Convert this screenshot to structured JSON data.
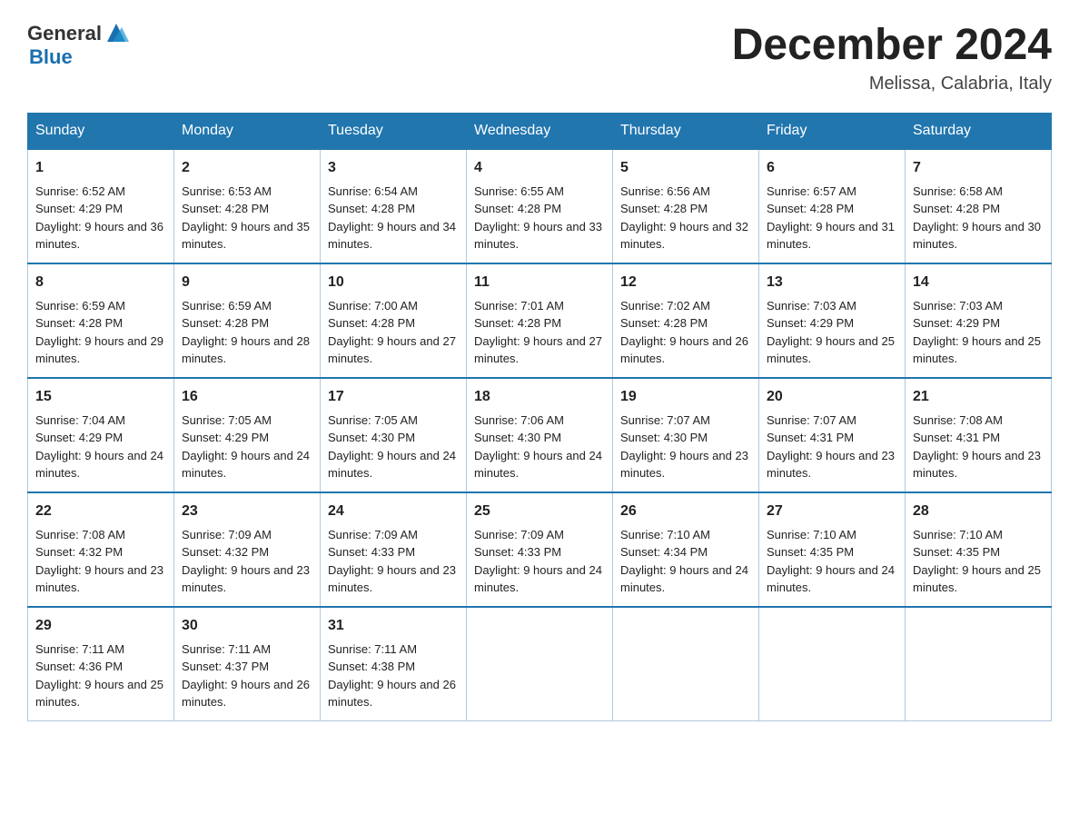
{
  "header": {
    "logo_general": "General",
    "logo_blue": "Blue",
    "month_title": "December 2024",
    "location": "Melissa, Calabria, Italy"
  },
  "weekdays": [
    "Sunday",
    "Monday",
    "Tuesday",
    "Wednesday",
    "Thursday",
    "Friday",
    "Saturday"
  ],
  "weeks": [
    [
      {
        "day": "1",
        "sunrise": "6:52 AM",
        "sunset": "4:29 PM",
        "daylight": "9 hours and 36 minutes."
      },
      {
        "day": "2",
        "sunrise": "6:53 AM",
        "sunset": "4:28 PM",
        "daylight": "9 hours and 35 minutes."
      },
      {
        "day": "3",
        "sunrise": "6:54 AM",
        "sunset": "4:28 PM",
        "daylight": "9 hours and 34 minutes."
      },
      {
        "day": "4",
        "sunrise": "6:55 AM",
        "sunset": "4:28 PM",
        "daylight": "9 hours and 33 minutes."
      },
      {
        "day": "5",
        "sunrise": "6:56 AM",
        "sunset": "4:28 PM",
        "daylight": "9 hours and 32 minutes."
      },
      {
        "day": "6",
        "sunrise": "6:57 AM",
        "sunset": "4:28 PM",
        "daylight": "9 hours and 31 minutes."
      },
      {
        "day": "7",
        "sunrise": "6:58 AM",
        "sunset": "4:28 PM",
        "daylight": "9 hours and 30 minutes."
      }
    ],
    [
      {
        "day": "8",
        "sunrise": "6:59 AM",
        "sunset": "4:28 PM",
        "daylight": "9 hours and 29 minutes."
      },
      {
        "day": "9",
        "sunrise": "6:59 AM",
        "sunset": "4:28 PM",
        "daylight": "9 hours and 28 minutes."
      },
      {
        "day": "10",
        "sunrise": "7:00 AM",
        "sunset": "4:28 PM",
        "daylight": "9 hours and 27 minutes."
      },
      {
        "day": "11",
        "sunrise": "7:01 AM",
        "sunset": "4:28 PM",
        "daylight": "9 hours and 27 minutes."
      },
      {
        "day": "12",
        "sunrise": "7:02 AM",
        "sunset": "4:28 PM",
        "daylight": "9 hours and 26 minutes."
      },
      {
        "day": "13",
        "sunrise": "7:03 AM",
        "sunset": "4:29 PM",
        "daylight": "9 hours and 25 minutes."
      },
      {
        "day": "14",
        "sunrise": "7:03 AM",
        "sunset": "4:29 PM",
        "daylight": "9 hours and 25 minutes."
      }
    ],
    [
      {
        "day": "15",
        "sunrise": "7:04 AM",
        "sunset": "4:29 PM",
        "daylight": "9 hours and 24 minutes."
      },
      {
        "day": "16",
        "sunrise": "7:05 AM",
        "sunset": "4:29 PM",
        "daylight": "9 hours and 24 minutes."
      },
      {
        "day": "17",
        "sunrise": "7:05 AM",
        "sunset": "4:30 PM",
        "daylight": "9 hours and 24 minutes."
      },
      {
        "day": "18",
        "sunrise": "7:06 AM",
        "sunset": "4:30 PM",
        "daylight": "9 hours and 24 minutes."
      },
      {
        "day": "19",
        "sunrise": "7:07 AM",
        "sunset": "4:30 PM",
        "daylight": "9 hours and 23 minutes."
      },
      {
        "day": "20",
        "sunrise": "7:07 AM",
        "sunset": "4:31 PM",
        "daylight": "9 hours and 23 minutes."
      },
      {
        "day": "21",
        "sunrise": "7:08 AM",
        "sunset": "4:31 PM",
        "daylight": "9 hours and 23 minutes."
      }
    ],
    [
      {
        "day": "22",
        "sunrise": "7:08 AM",
        "sunset": "4:32 PM",
        "daylight": "9 hours and 23 minutes."
      },
      {
        "day": "23",
        "sunrise": "7:09 AM",
        "sunset": "4:32 PM",
        "daylight": "9 hours and 23 minutes."
      },
      {
        "day": "24",
        "sunrise": "7:09 AM",
        "sunset": "4:33 PM",
        "daylight": "9 hours and 23 minutes."
      },
      {
        "day": "25",
        "sunrise": "7:09 AM",
        "sunset": "4:33 PM",
        "daylight": "9 hours and 24 minutes."
      },
      {
        "day": "26",
        "sunrise": "7:10 AM",
        "sunset": "4:34 PM",
        "daylight": "9 hours and 24 minutes."
      },
      {
        "day": "27",
        "sunrise": "7:10 AM",
        "sunset": "4:35 PM",
        "daylight": "9 hours and 24 minutes."
      },
      {
        "day": "28",
        "sunrise": "7:10 AM",
        "sunset": "4:35 PM",
        "daylight": "9 hours and 25 minutes."
      }
    ],
    [
      {
        "day": "29",
        "sunrise": "7:11 AM",
        "sunset": "4:36 PM",
        "daylight": "9 hours and 25 minutes."
      },
      {
        "day": "30",
        "sunrise": "7:11 AM",
        "sunset": "4:37 PM",
        "daylight": "9 hours and 26 minutes."
      },
      {
        "day": "31",
        "sunrise": "7:11 AM",
        "sunset": "4:38 PM",
        "daylight": "9 hours and 26 minutes."
      },
      null,
      null,
      null,
      null
    ]
  ],
  "labels": {
    "sunrise": "Sunrise:",
    "sunset": "Sunset:",
    "daylight": "Daylight:"
  }
}
